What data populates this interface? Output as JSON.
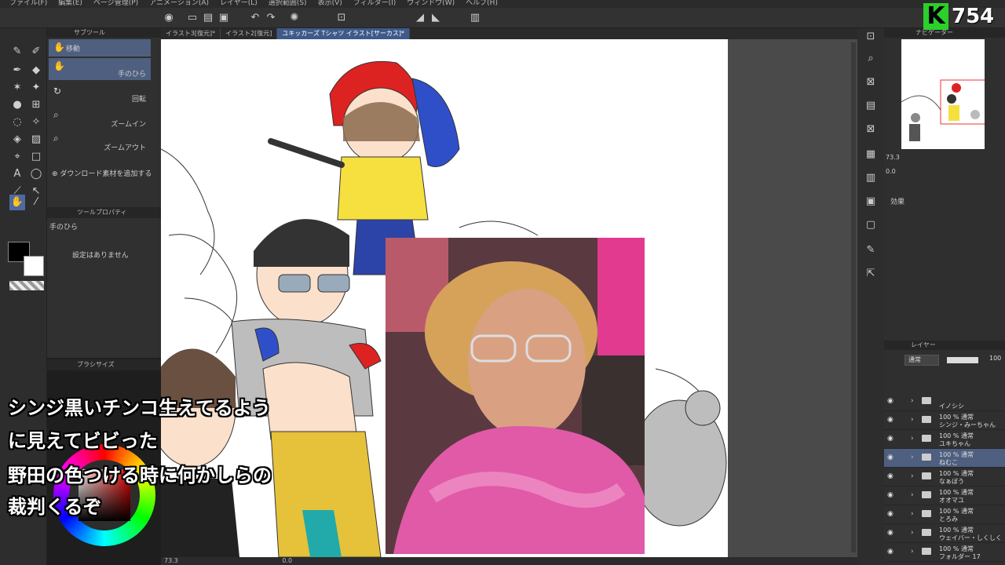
{
  "menu": [
    "ファイル(F)",
    "編集(E)",
    "ページ管理(P)",
    "アニメーション(A)",
    "レイヤー(L)",
    "選択範囲(S)",
    "表示(V)",
    "フィルター(I)",
    "ウィンドウ(W)",
    "ヘルプ(H)"
  ],
  "subtool": {
    "header": "サブツール",
    "items": [
      {
        "label": "移動"
      },
      {
        "label": "手のひら"
      },
      {
        "label": "回転"
      },
      {
        "label": "ズームイン"
      },
      {
        "label": "ズームアウト"
      }
    ],
    "add_material": "ダウンロード素材を追加する"
  },
  "tool_property": {
    "header": "ツールプロパティ",
    "title": "手のひら",
    "empty": "設定はありません"
  },
  "brush_size_header": "ブラシサイズ",
  "tabs": [
    "イラスト3[復元]*",
    "イラスト2[復元]",
    "ユキッカーズ Tシャツ イラスト[サーカス]*"
  ],
  "canvas_status": {
    "zoom": "73.3",
    "angle": "0.0"
  },
  "badge": {
    "letter": "K",
    "value": "754",
    "color": "#2ccf2c"
  },
  "captions": [
    "シンジ黒いチンコ生えてるよう",
    "に見えてビビった",
    "野田の色つける時に何かしらの",
    "裁判くるぞ"
  ],
  "navigator": {
    "header": "ナビゲーター",
    "zoom": "73.3",
    "angle": "0.0"
  },
  "effect_label": "効果",
  "layers": {
    "header": "レイヤー",
    "blend_mode": "通常",
    "opacity": "100",
    "items": [
      {
        "mode": "",
        "name": "イノシシ"
      },
      {
        "mode": "100 % 通常",
        "name": "シンジ・みーちゃん"
      },
      {
        "mode": "100 % 通常",
        "name": "ユキちゃん"
      },
      {
        "mode": "100 % 通常",
        "name": "ねむこ"
      },
      {
        "mode": "100 % 通常",
        "name": "なぁぼう"
      },
      {
        "mode": "100 % 通常",
        "name": "オオマユ"
      },
      {
        "mode": "100 % 通常",
        "name": "とろみ"
      },
      {
        "mode": "100 % 通常",
        "name": "ウェイバー・しくしく"
      },
      {
        "mode": "100 % 通常",
        "name": "フォルダー 17"
      }
    ]
  }
}
